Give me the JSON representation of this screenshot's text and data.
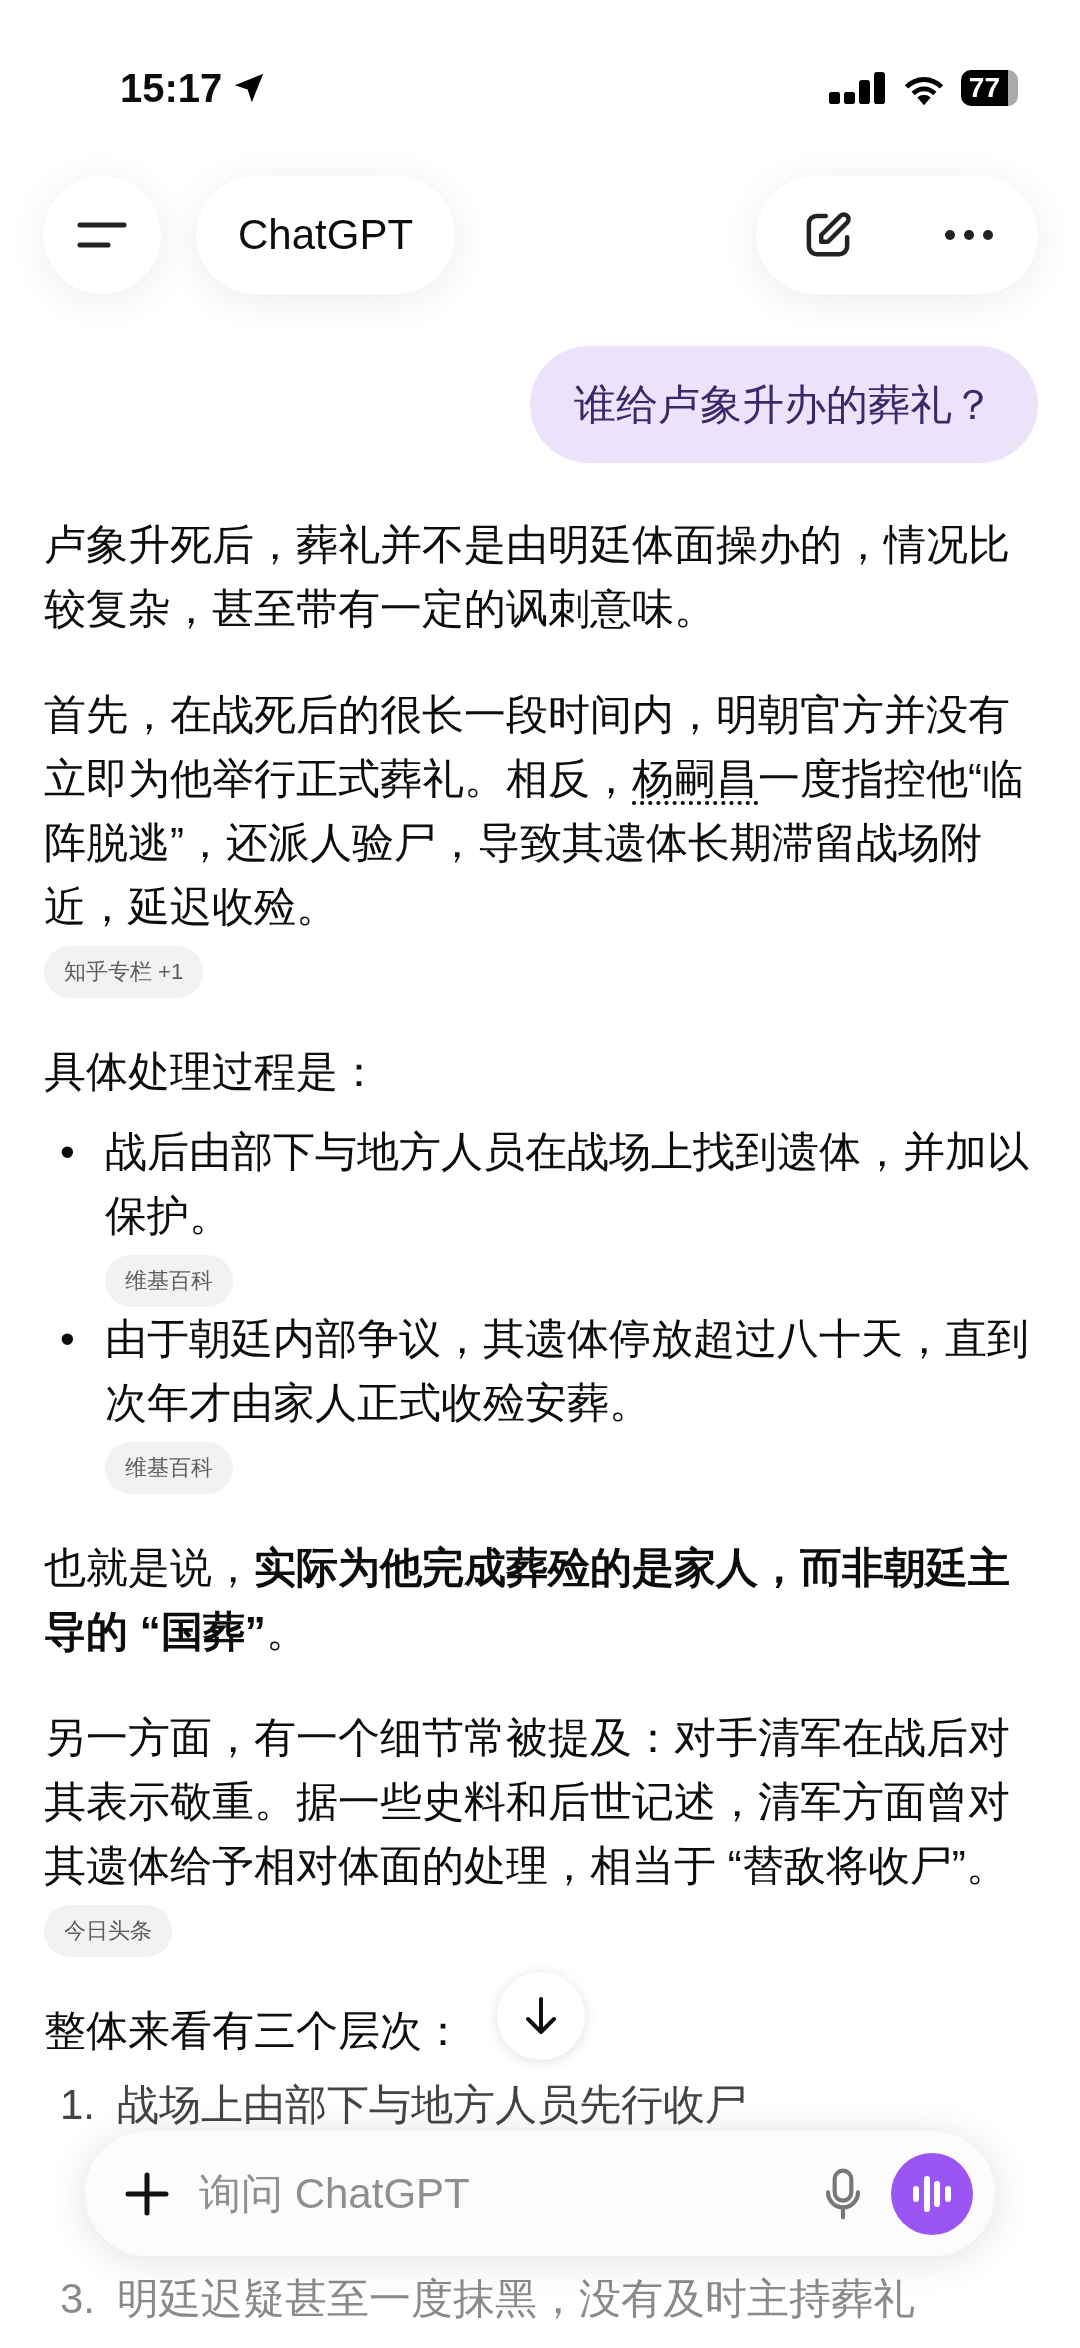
{
  "status_bar": {
    "time": "15:17",
    "battery": "77"
  },
  "header": {
    "title": "ChatGPT"
  },
  "user_message": "谁给卢象升办的葬礼？",
  "blocks": [
    {
      "kind": "paragraph",
      "segments": [
        {
          "kind": "plain",
          "text": "卢象升死后，葬礼并不是由明廷体面操办的，情况比较复杂，甚至带有一定的讽刺意味。"
        }
      ]
    },
    {
      "kind": "paragraph",
      "segments": [
        {
          "kind": "plain",
          "text": "首先，在战死后的很长一段时间内，明朝官方并没有立即为他举行正式葬礼。相反，"
        },
        {
          "kind": "link",
          "text": "杨嗣昌"
        },
        {
          "kind": "plain",
          "text": "一度指控他“临阵脱逃”，还派人验尸，导致其遗体长期滞留战场附近，延迟收殓。"
        }
      ],
      "cite": "知乎专栏 +1"
    },
    {
      "kind": "paragraph",
      "segments": [
        {
          "kind": "plain",
          "text": "具体处理过程是："
        }
      ]
    },
    {
      "kind": "bullets",
      "items": [
        {
          "marker": "•",
          "text": "战后由部下与地方人员在战场上找到遗体，并加以保护。",
          "cite": "维基百科"
        },
        {
          "marker": "•",
          "text": "由于朝廷内部争议，其遗体停放超过八十天，直到次年才由家人正式收殓安葬。",
          "cite": "维基百科"
        }
      ]
    },
    {
      "kind": "paragraph",
      "segments": [
        {
          "kind": "plain",
          "text": "也就是说，**实际为他完成葬殓的是家人，而非朝廷主导的 “国葬”**。"
        }
      ]
    },
    {
      "kind": "paragraph",
      "segments": [
        {
          "kind": "plain",
          "text": "另一方面，有一个细节常被提及：对手清军在战后对其表示敬重。据一些史料和后世记述，清军方面曾对其遗体给予相对体面的处理，相当于 “替敌将收尸”。"
        }
      ],
      "cite": "今日头条"
    },
    {
      "kind": "paragraph",
      "segments": [
        {
          "kind": "plain",
          "text": "整体来看有三个层次："
        }
      ]
    },
    {
      "kind": "numbered",
      "items": [
        {
          "number": "1.",
          "text": "战场上由部下与地方人员先行收尸"
        },
        {
          "number": "3.",
          "text": "明廷迟疑甚至一度抹黑，没有及时主持葬礼"
        }
      ]
    }
  ],
  "composer": {
    "placeholder": "询问 ChatGPT"
  }
}
